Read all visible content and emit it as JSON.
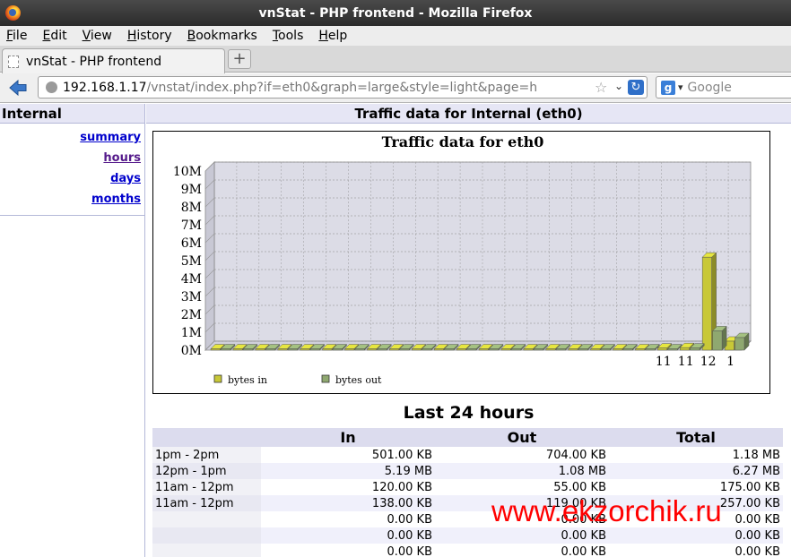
{
  "window": {
    "title": "vnStat - PHP frontend - Mozilla Firefox"
  },
  "menubar": {
    "items": [
      "File",
      "Edit",
      "View",
      "History",
      "Bookmarks",
      "Tools",
      "Help"
    ]
  },
  "tab": {
    "title": "vnStat - PHP frontend"
  },
  "urlbar": {
    "host": "192.168.1.17",
    "path": "/vnstat/index.php?if=eth0&graph=large&style=light&page=h"
  },
  "search": {
    "placeholder": "Google"
  },
  "sidebar": {
    "title": "Internal",
    "links": [
      {
        "label": "summary",
        "visited": false
      },
      {
        "label": "hours",
        "visited": true
      },
      {
        "label": "days",
        "visited": false
      },
      {
        "label": "months",
        "visited": false
      }
    ]
  },
  "main": {
    "title": "Traffic data for Internal (eth0)"
  },
  "chart_data": {
    "type": "bar",
    "title": "Traffic data for eth0",
    "y_ticks": [
      "10M",
      "9M",
      "8M",
      "7M",
      "6M",
      "5M",
      "4M",
      "3M",
      "2M",
      "1M",
      "0M"
    ],
    "ylim": [
      0,
      10
    ],
    "x_tick_labels": [
      "11",
      "11",
      "12",
      "1"
    ],
    "series": [
      {
        "name": "bytes in",
        "color": "#c8c837",
        "values": [
          0,
          0,
          0,
          0,
          0,
          0,
          0,
          0,
          0,
          0,
          0,
          0,
          0,
          0,
          0,
          0,
          0,
          0,
          0,
          0,
          0.12,
          0.14,
          5.19,
          0.5
        ]
      },
      {
        "name": "bytes out",
        "color": "#8fa870",
        "values": [
          0,
          0,
          0,
          0,
          0,
          0,
          0,
          0,
          0,
          0,
          0,
          0,
          0,
          0,
          0,
          0,
          0,
          0,
          0,
          0,
          0.06,
          0.12,
          1.08,
          0.7
        ]
      }
    ],
    "legend": [
      {
        "name": "bytes in",
        "color": "#c8c837"
      },
      {
        "name": "bytes out",
        "color": "#8fa870"
      }
    ]
  },
  "table": {
    "title": "Last 24 hours",
    "headers": [
      "",
      "In",
      "Out",
      "Total"
    ],
    "rows": [
      {
        "label": "1pm - 2pm",
        "in": "501.00 KB",
        "out": "704.00 KB",
        "total": "1.18 MB"
      },
      {
        "label": "12pm - 1pm",
        "in": "5.19 MB",
        "out": "1.08 MB",
        "total": "6.27 MB"
      },
      {
        "label": "11am - 12pm",
        "in": "120.00 KB",
        "out": "55.00 KB",
        "total": "175.00 KB"
      },
      {
        "label": "11am - 12pm",
        "in": "138.00 KB",
        "out": "119.00 KB",
        "total": "257.00 KB"
      },
      {
        "label": "",
        "in": "0.00 KB",
        "out": "0.00 KB",
        "total": "0.00 KB"
      },
      {
        "label": "",
        "in": "0.00 KB",
        "out": "0.00 KB",
        "total": "0.00 KB"
      },
      {
        "label": "",
        "in": "0.00 KB",
        "out": "0.00 KB",
        "total": "0.00 KB"
      }
    ]
  },
  "watermark": "www.ekzorchik.ru"
}
